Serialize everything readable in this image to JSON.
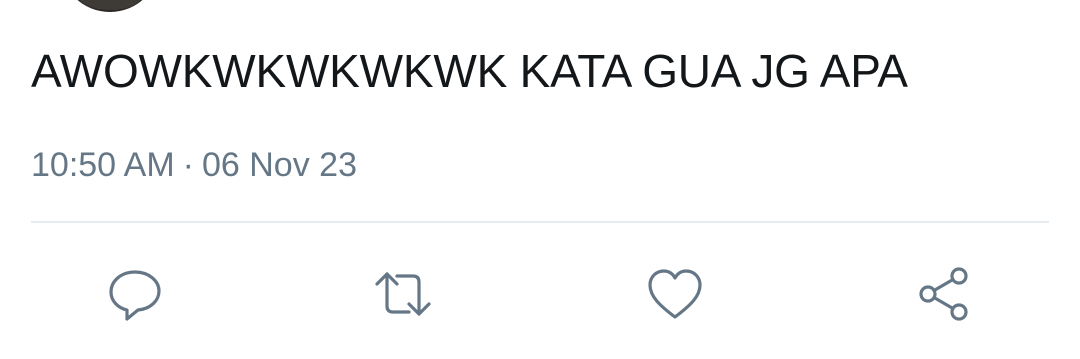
{
  "tweet": {
    "text": "AWOWKWKWKWKWK KATA GUA JG APA",
    "time": "10:50 AM",
    "separator": "·",
    "date": "06 Nov 23"
  },
  "actions": {
    "reply_icon": "reply-bubble-icon",
    "retweet_icon": "retweet-arrows-icon",
    "like_icon": "heart-icon",
    "share_icon": "share-nodes-icon",
    "icon_color": "#657786"
  },
  "colors": {
    "text": "#14171a",
    "meta": "#657786",
    "divider": "#e6ecf0"
  }
}
